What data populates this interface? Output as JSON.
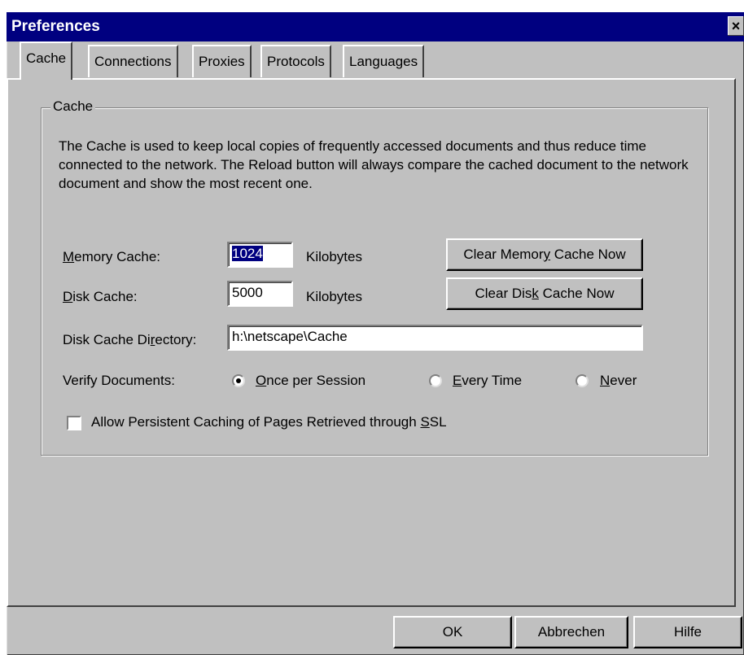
{
  "window": {
    "title": "Preferences",
    "close_glyph": "×"
  },
  "tabs": [
    {
      "label": "Cache",
      "active": true
    },
    {
      "label": "Connections",
      "active": false
    },
    {
      "label": "Proxies",
      "active": false
    },
    {
      "label": "Protocols",
      "active": false
    },
    {
      "label": "Languages",
      "active": false
    }
  ],
  "cache_group": {
    "legend": "Cache",
    "description": "The Cache is used to keep local copies of frequently accessed documents and thus reduce time connected to the network. The Reload button will always compare the cached document to the network document and show the most recent one.",
    "memory_cache": {
      "label_prefix": "",
      "label_accel": "M",
      "label_rest": "emory Cache:",
      "value": "1024",
      "unit": "Kilobytes"
    },
    "disk_cache": {
      "label_accel": "D",
      "label_rest": "isk Cache:",
      "value": "5000",
      "unit": "Kilobytes"
    },
    "clear_memory_button": {
      "pre": "Clear Memor",
      "accel": "y",
      "post": " Cache Now"
    },
    "clear_disk_button": {
      "pre": "Clear Dis",
      "accel": "k",
      "post": " Cache Now"
    },
    "disk_directory": {
      "label_pre": "Disk Cache Di",
      "label_accel": "r",
      "label_post": "ectory:",
      "value": "h:\\netscape\\Cache"
    },
    "verify": {
      "label": "Verify Documents:",
      "options": [
        {
          "accel": "O",
          "rest": "nce per Session",
          "selected": true
        },
        {
          "accel": "E",
          "rest": "very Time",
          "selected": false
        },
        {
          "accel": "N",
          "rest": "ever",
          "selected": false
        }
      ]
    },
    "ssl_checkbox": {
      "pre": "Allow Persistent Caching of Pages Retrieved through ",
      "accel": "S",
      "post": "SL",
      "checked": false
    }
  },
  "footer": {
    "ok": "OK",
    "cancel": "Abbrechen",
    "help": "Hilfe"
  }
}
